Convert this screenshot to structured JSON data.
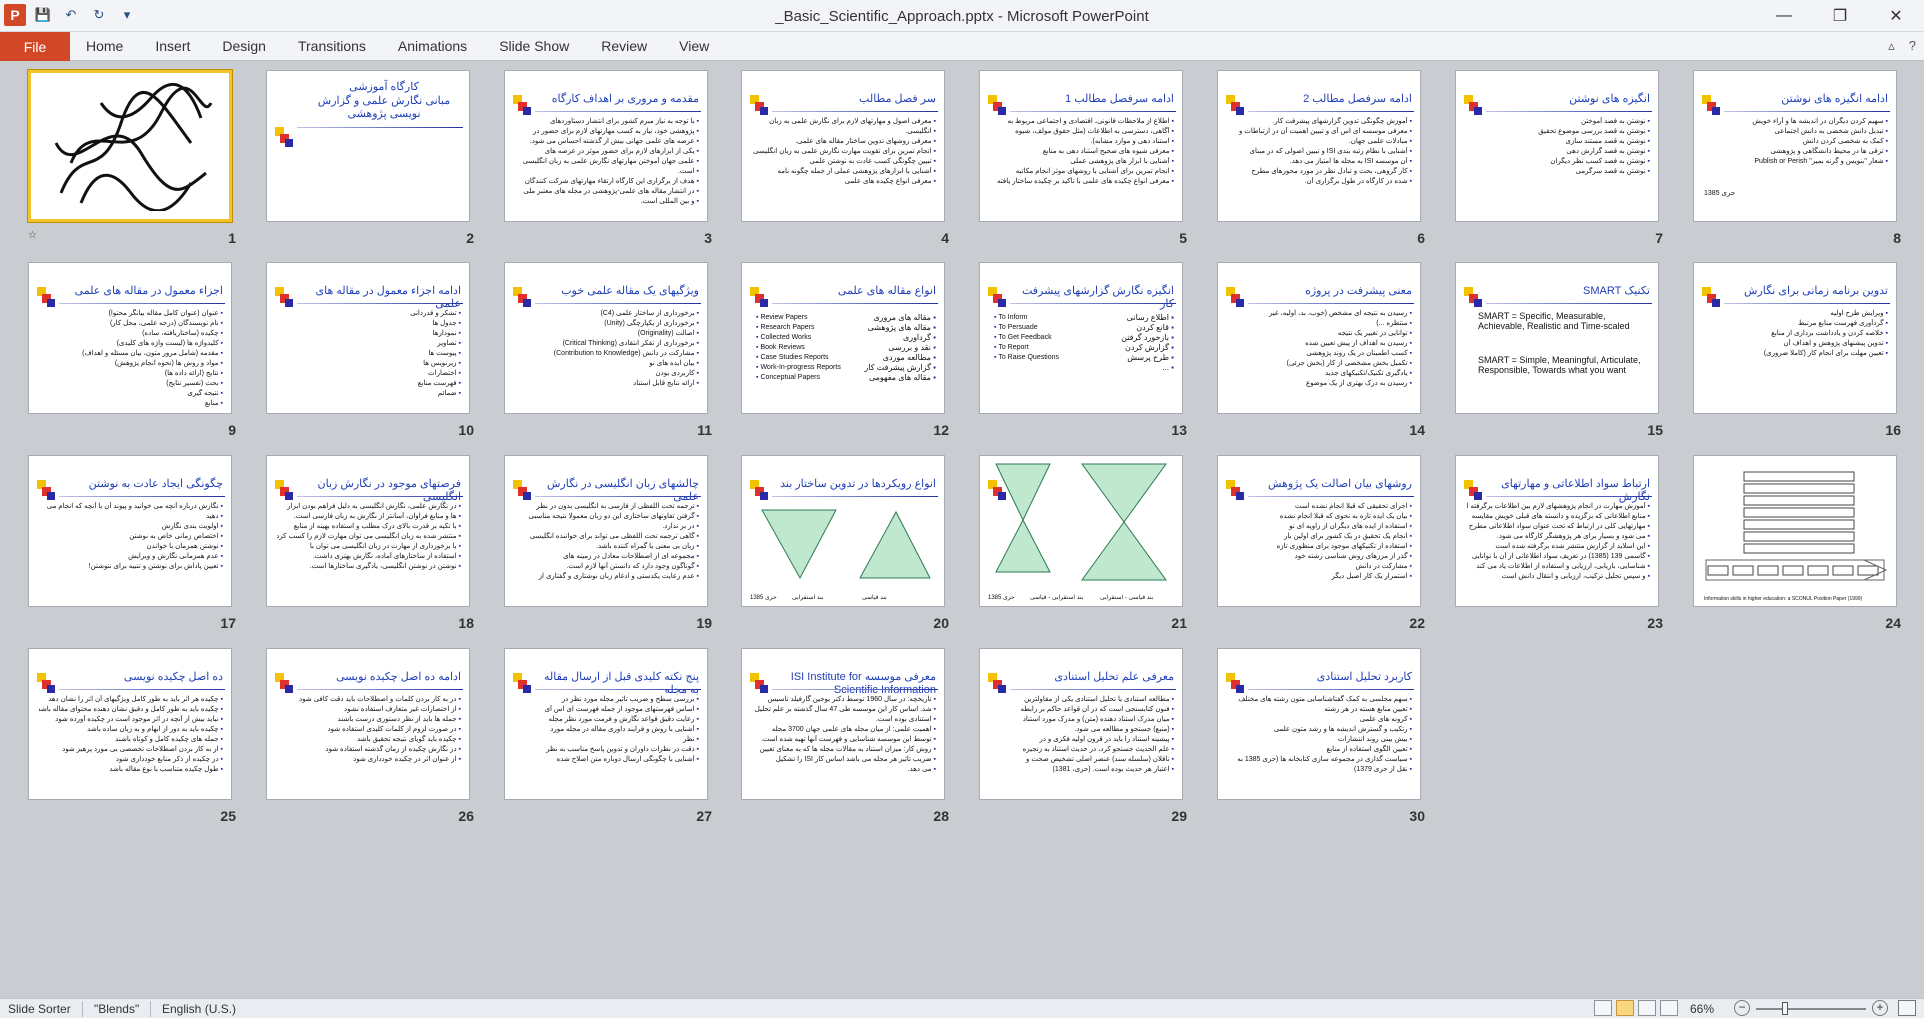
{
  "window": {
    "title": "_Basic_Scientific_Approach.pptx - Microsoft PowerPoint",
    "app_icon": "P",
    "controls": {
      "minimize": "—",
      "restore": "❐",
      "close": "✕"
    }
  },
  "quick_access": {
    "save_icon": "💾",
    "undo_icon": "↶",
    "redo_icon": "↻",
    "customize_icon": "▾"
  },
  "ribbon": {
    "file_label": "File",
    "tabs": [
      "Home",
      "Insert",
      "Design",
      "Transitions",
      "Animations",
      "Slide Show",
      "Review",
      "View"
    ],
    "minimize_icon": "▵",
    "help_icon": "?"
  },
  "slides": [
    {
      "num": "1",
      "kind": "calligraphy",
      "title": ""
    },
    {
      "num": "2",
      "kind": "title",
      "title": "کارگاه آموزشی",
      "subtitle": "مبانی نگارش علمی و گزارش نویسی پژوهشی"
    },
    {
      "num": "3",
      "kind": "text",
      "title": "مقدمه و مروری بر اهداف کارگاه",
      "bullets": [
        "با توجه به نیاز مبرم کشور برای انتشار دستاوردهای",
        "پژوهشی خود، نیاز به کسب مهارتهای لازم برای حضور در",
        "عرصه های علمی جهانی بیش از گذشته احساس می شود.",
        "یکی از ابزارهای لازم برای حضور موثر در عرصه های",
        "علمی جهان آموختن مهارتهای نگارش علمی به زبان انگلیسی",
        "است.",
        "هدف از برگزاری این کارگاه ارتقاء مهارتهای شرکت کنندگان",
        "در انتشار مقاله های علمی-پژوهشی در مجله های معتبر ملی",
        "و بین المللی است."
      ]
    },
    {
      "num": "4",
      "kind": "text",
      "title": "سر فصل مطالب",
      "bullets": [
        "معرفی اصول و مهارتهای لازم برای نگارش علمی به زبان",
        "انگلیسی.",
        "معرفی روشهای تدوین ساختار مقاله های علمی.",
        "انجام تمرین برای تقویت مهارت نگارش علمی به زبان انگلیسی",
        "تبیین چگونگی کسب عادت به نوشتن علمی",
        "آشنایی با ابزارهای پژوهشی عملی از جمله چگونه نامه",
        "معرفی انواع چکیده های علمی"
      ]
    },
    {
      "num": "5",
      "kind": "text",
      "title": "ادامه سرفصل مطالب 1",
      "bullets": [
        "اطلاع از ملاحظات قانونی، اقتصادی و اجتماعی مربوط به",
        "آگاهی، دسترسی به اطلاعات (مثل حقوق مولف، شیوه",
        "استناد دهی و موارد مشابه).",
        "معرفی شیوه های صحیح استناد دهی به منابع",
        "آشنایی با ابزار های پژوهشی عملی",
        "انجام تمرین برای آشنایی با روشهای موثر انجام مکاتبه",
        "معرفی انواع چکیده های علمی با تاکید بر چکیده ساختار یافته"
      ]
    },
    {
      "num": "6",
      "kind": "text",
      "title": "ادامه سرفصل مطالب 2",
      "bullets": [
        "آموزش چگونگی تدوین گزارشهای پیشرفت کار.",
        "معرفی موسسه ای اس آی و تبیین اهمیت آن در ارتباطات و",
        "مبادلات علمی جهان.",
        "آشنایی با نظام رتبه بندی ISI و تبیین اصولی که در مبنای",
        "آن موسسه ISI به مجله ها امتیاز می دهد.",
        "کار گروهی، بحث و تبادل نظر در مورد محورهای مطرح",
        "شده در کارگاه در طول برگزاری آن."
      ]
    },
    {
      "num": "7",
      "kind": "text",
      "title": "انگیزه های نوشتن",
      "bullets": [
        "نوشتن به قصد آموختن",
        "نوشتن به قصد بررسی موضوع تحقیق",
        "نوشتن به قصد مستند سازی",
        "نوشتن به قصد گزارش دهی",
        "نوشتن به قصد کسب نظر دیگران",
        "نوشتن به قصد سرگرمی"
      ]
    },
    {
      "num": "8",
      "kind": "text",
      "title": "ادامه انگیزه های نوشتن",
      "bullets": [
        "سهیم کردن دیگران در اندیشه ها و آراء خویش",
        "تبدیل دانش شخصی به دانش اجتماعی",
        "کمک به شخصی کردن دانش",
        "ترقی ها در محیط دانشگاهی و پژوهشی",
        "شعار \"بنویس و گرنه بمیر\" Publish or Perish"
      ],
      "extra": "حری 1385"
    },
    {
      "num": "9",
      "kind": "text",
      "title": "اجزاء معمول در مقاله های علمی",
      "bullets": [
        "عنوان (عنوان کامل مقاله بیانگر محتوا)",
        "نام نویسندگان (درجه علمی، محل کار)",
        "چکیده (ساختاریافته، ساده)",
        "کلیدواژه ها (لیست واژه های کلیدی)",
        "مقدمه (شامل مرور متون، بیان مسئله و اهداف)",
        "مواد و روش ها (نحوه انجام پژوهش)",
        "نتایج (ارائه داده ها)",
        "بحث (تفسیر نتایج)",
        "نتیجه گیری",
        "منابع"
      ]
    },
    {
      "num": "10",
      "kind": "text",
      "title": "ادامه اجزاء معمول در مقاله های علمی",
      "bullets": [
        "تشکر و قدردانی",
        "جدول ها",
        "نمودارها",
        "تصاویر",
        "پیوست ها",
        "زیرنویس ها",
        "اختصارات",
        "فهرست منابع",
        "ضمائم"
      ]
    },
    {
      "num": "11",
      "kind": "text",
      "title": "ویژگیهای یک مقاله علمی خوب",
      "bullets": [
        "برخورداری از ساختار علمی (C4)",
        "برخورداری از یکپارچگی (Unity)",
        "اصالت (Originality)",
        "برخورداری از تفکر انتقادی (Critical Thinking)",
        "مشارکت در دانش (Contribution to Knowledge)",
        "بیان ایده های نو",
        "کاربردی بودن",
        "ارائه نتایج قابل استناد"
      ]
    },
    {
      "num": "12",
      "kind": "bilingual",
      "title": "انواع مقاله های علمی",
      "left": [
        "Review Papers",
        "Research Papers",
        "Collected Works",
        "Book Reviews",
        "Case Studies Reports",
        "Work-In-progress Reports",
        "Conceptual Papers"
      ],
      "right": [
        "مقاله های مروری",
        "مقاله های پژوهشی",
        "گردآوری",
        "نقد و بررسی",
        "مطالعه موردی",
        "گزارش پیشرفت کار",
        "مقاله های مفهومی"
      ]
    },
    {
      "num": "13",
      "kind": "bilingual",
      "title": "انگیزه نگارش گزارشهای پیشرفت کار",
      "left": [
        "To Inform",
        "To Persuade",
        "To Get Feedback",
        "To Report",
        "To Raise Questions"
      ],
      "right": [
        "اطلاع رسانی",
        "قانع کردن",
        "بازخورد گرفتن",
        "گزارش کردن",
        "طرح پرسش",
        "..."
      ]
    },
    {
      "num": "14",
      "kind": "text",
      "title": "معنی پیشرفت در پروژه",
      "bullets": [
        "رسیدن به نتیجه ای مشخص (خوب، بد، اولیه، غیر",
        "منتظره ...)",
        "توانایی در تغییر یک نتیجه",
        "رسیدن به اهداف از پیش تعیین شده",
        "کسب اطمینان در یک روند پژوهشی",
        "تکمیل بخش مشخصی از کار (بخش جزئی)",
        "یادگیری تکنیک/تکنیکهای جدید",
        "رسیدن به درک بهتری از یک موضوع"
      ]
    },
    {
      "num": "15",
      "kind": "smart",
      "title": "تکنیک SMART",
      "lines": [
        "SMART = Specific, Measurable, Achievable, Realistic and Time-scaled",
        "SMART = Simple, Meaningful, Articulate, Responsible, Towards what you want"
      ]
    },
    {
      "num": "16",
      "kind": "text",
      "title": "تدوین برنامه زمانی برای نگارش",
      "bullets": [
        "ویرایش طرح اولیه",
        "گردآوری فهرست منابع مرتبط",
        "خلاصه کردن و یادداشت برداری از منابع",
        "تدوین پیشنهای پژوهش و اهداف آن",
        "تعیین مهلت برای انجام کار (کاملا ضروری)"
      ]
    },
    {
      "num": "17",
      "kind": "text",
      "title": "چگونگی ایجاد عادت به نوشتن",
      "bullets": [
        "نگارش درباره آنچه می خوانید و پیوند آن با آنچه که انجام می",
        "دهید",
        "اولویت بندی نگارش",
        "اختصاص زمانی خاص به نوشتن",
        "نوشتن همزمان با خواندن",
        "عدم همزمانی نگارش و ویرایش",
        "تعیین پاداش برای نوشتن و تنبیه برای ننوشتن!"
      ]
    },
    {
      "num": "18",
      "kind": "text",
      "title": "فرصتهای موجود در نگارش زبان انگلیسی",
      "bullets": [
        "در نگارش علمی، نگارش انگلیسی به دلیل فراهم بودن ابزار",
        "ها و منابع فراوان، آسانتر از نگارش به زبان فارسی است.",
        "با تکیه بر قدرت بالای درک مطلب و استفاده بهینه از منابع",
        "منتشر شده به زبان انگلیسی می توان مهارت لازم را کسب کرد.",
        "با برخورداری از مهارت در زبان انگلیسی می توان با",
        "استفاده از ساختارهای آماده، نگارش بهتری داشت.",
        "نوشتن در نوشتن انگلیسی، یادگیری ساختارها است."
      ]
    },
    {
      "num": "19",
      "kind": "text",
      "title": "چالشهای زبان انگلیسی در نگارش علمی",
      "bullets": [
        "ترجمه تحت اللفظی از فارسی به انگلیسی بدون در نظر",
        "گرفتن تفاوتهای ساختاری این دو زبان معمولا نتیجه مناسبی",
        "در بر ندارد.",
        "گاهی ترجمه تحت اللفظی می تواند برای خواننده انگلیسی",
        "زبان بی معنی یا گمراه کننده باشد.",
        "مجموعه ای از اصطلاحات معادل در زمینه های",
        "گوناگون وجود دارد که دانستن آنها لازم است.",
        "عدم رعایت یکدستی و ادغام زبان نوشتاری و گفتاری از"
      ]
    },
    {
      "num": "20",
      "kind": "cones",
      "title": "انواع رویکردها در تدوین ساختار بند",
      "labels": [
        "بند قیاسی",
        "بند استقرایی",
        "حری 1385"
      ]
    },
    {
      "num": "21",
      "kind": "hourglass",
      "title": "",
      "labels": [
        "بند قیاسی - استقرایی",
        "بند استقرایی - قیاسی",
        "حری 1385"
      ]
    },
    {
      "num": "22",
      "kind": "text",
      "title": "روشهای بیان اصالت یک پژوهش",
      "bullets": [
        "اجرای تحقیقی که قبلا انجام نشده است",
        "بیان یک ایده تازه به نحوی که قبلا انجام نشده",
        "استفاده از ایده های دیگران از زاویه ای نو",
        "انجام یک تحقیق در یک کشور برای اولین بار",
        "استفاده از تکنیکهای موجود برای منظوری تازه",
        "گذر از مرزهای روش شناسی رشته خود",
        "مشارکت در دانش",
        "استمرار یک کار اصیل دیگر"
      ]
    },
    {
      "num": "23",
      "kind": "text",
      "title": "ارتباط سواد اطلاعاتی و مهارتهای نگارش",
      "bullets": [
        "آموزش مهارت در انجام پژوهشهای لازم بین اطلاعات برگرفته از",
        "منابع اطلاعاتی که برگزیده و دانسته های قبلی خویش مقایسه",
        "مهارتهایی کلی در ارتباط که تحت عنوان سواد اطلاعاتی مطرح",
        "می شود و بسیار برای هر پژوهشگر کارگاه می شود.",
        "این اسلاید از گزارش منتشر شده برگرفته شده است",
        "گاسمی 139 (1385) در تعریف سواد اطلاعاتی از آن با توانایی",
        "شناسایی، بازیابی، ارزیابی و استفاده از اطلاعات یاد می کند",
        "و سپس تحلیل ترکیب، ارزیابی و انتقال دانش است"
      ]
    },
    {
      "num": "24",
      "kind": "flow",
      "title": "",
      "caption": "Information skills in higher education: a SCONUL Position Paper (1999)"
    },
    {
      "num": "25",
      "kind": "text",
      "title": "ده اصل چکیده نویسی",
      "bullets": [
        "چکیده هر اثر باید به طور کامل ویژگیهای آن اثر را نشان دهد",
        "چکیده باید به طور کامل و دقیق نشان دهنده محتوای مقاله باشد",
        "نباید بیش از آنچه در اثر موجود است در چکیده آورده شود",
        "چکیده باید به دور از ابهام و به زبان ساده باشد",
        "جمله های چکیده کامل و کوتاه باشند",
        "از به کار بردن اصطلاحات تخصصی بی مورد پرهیز شود",
        "در چکیده از ذکر منابع خودداری شود",
        "طول چکیده متناسب با نوع مقاله باشد"
      ]
    },
    {
      "num": "26",
      "kind": "text",
      "title": "ادامه ده اصل چکیده نویسی",
      "bullets": [
        "در به کار بردن کلمات و اصطلاحات باید دقت کافی شود",
        "از اختصارات غیر متعارف استفاده نشود",
        "جمله ها باید از نظر دستوری درست باشند",
        "در صورت لزوم از کلمات کلیدی استفاده شود",
        "چکیده باید گویای نتیجه تحقیق باشد",
        "در نگارش چکیده از زمان گذشته استفاده شود",
        "از عنوان اثر در چکیده خودداری شود"
      ]
    },
    {
      "num": "27",
      "kind": "text",
      "title": "پنج نکته کلیدی قبل از ارسال مقاله به مجله",
      "bullets": [
        "بررسی سطح و ضریب تاثیر مجله مورد نظر در",
        "اساس فهرستهای موجود از جمله فهرست ای اس آی",
        "رعایت دقیق قواعد نگارش و فرمت مورد نظر مجله",
        "آشنایی با روش و فرایند داوری مقاله در مجله مورد",
        "نظر",
        "دقت در نظرات داوران و تدوین پاسخ مناسب به نظر",
        "آشنایی با چگونگی ارسال دوباره متن اصلاح شده"
      ]
    },
    {
      "num": "28",
      "kind": "text",
      "title": "معرفی موسسه ISI Institute for Scientific Information",
      "bullets": [
        "تاریخچه: در سال 1960 توسط دکتر یوجین گارفیلد تاسیس",
        "شد. اساس کار این موسسه طی 47 سال گذشته بر علم تحلیل",
        "استنادی بوده است.",
        "اهمیت علمی: از میان مجله های علمی جهان 3700 مجله",
        "توسط این موسسه شناسایی و فهرست آنها تهیه شده است.",
        "روش کار: میزان استناد به مقالات مجله ها که به معنای تعیین",
        "ضریب تاثیر هر مجله می باشد اساس کار ISI را تشکیل",
        "می دهد."
      ]
    },
    {
      "num": "29",
      "kind": "text",
      "title": "معرفی علم تحلیل استنادی",
      "bullets": [
        "مطالعه استنادی یا تحلیل استنادی یکی از مقاولترین",
        "فنون کتابسنجی است که در آن قواعد حاکم بر رابطه",
        "میان مدرک استناد دهنده (متن) و مدرک مورد استناد",
        "(منبع) جستجو و مطالعه می شود.",
        "پیشینه استناد را باید در قرون اولیه فکری و در",
        "علم الحدیث جستجو کرد، در حدیث استناد به زنجیره",
        "ناقلان (سلسله سند) عنصر اصلی تشخیص صحت و",
        "اعتبار هر حدیث بوده است. (حری، 1381)"
      ]
    },
    {
      "num": "30",
      "kind": "text",
      "title": "کاربرد تحلیل استنادی",
      "bullets": [
        "سهم مجلسی به کمک گفتاشناسایی متون رشته های مختلف",
        "تعیین منابع هسته در هر رشته",
        "کرونه های علمی",
        "رتکیب و گسترش اندیشه ها و رشد متون علمی",
        "بیش بینی روند انتشارات",
        "تعیین الگوی استفاده از منابع",
        "سیاست گذاری در مجموعه سازی کتابخانه ها (حری 1385 به",
        "نقل از حری 1379)"
      ]
    }
  ],
  "statusbar": {
    "view": "Slide Sorter",
    "theme": "\"Blends\"",
    "language": "English (U.S.)",
    "zoom": "66%",
    "zoom_minus": "−",
    "zoom_plus": "+"
  },
  "colors": {
    "accent": "#d24726",
    "slide_title": "#1f3fb8",
    "selection": "#f0c52c"
  }
}
